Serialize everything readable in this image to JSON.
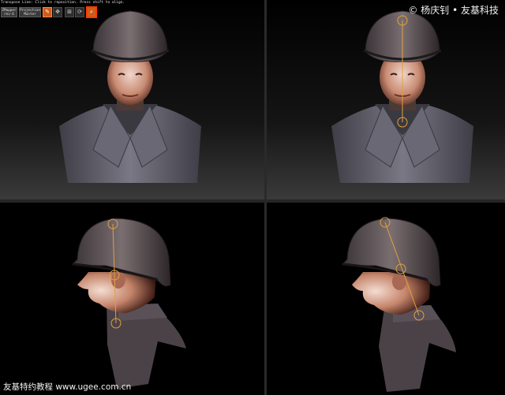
{
  "toolbar": {
    "hint": "Transpose Line: Click to reposition. Press shift to align.",
    "zmapper_label": "ZMapper",
    "zmapper_sub": "rev-E",
    "projection_label": "Projection",
    "projection_sub": "Master"
  },
  "watermark": {
    "top": "© 杨庆钊 • 友基科技",
    "bottom": "友基特约教程 www.ugee.com.cn"
  },
  "colors": {
    "accent": "#d15a1a",
    "transpose_line": "#e0a040",
    "skin": "#c98c73",
    "uniform": "#5c5a66"
  }
}
